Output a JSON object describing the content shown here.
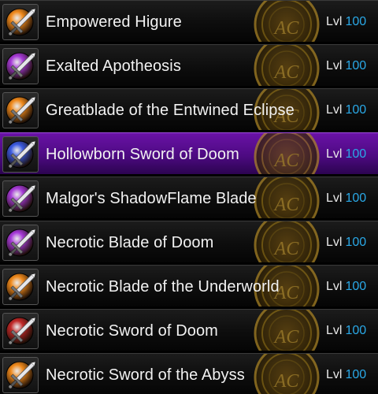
{
  "colors": {
    "row_bg": "#0d0d0d",
    "selected_bg": "#4d0a82",
    "text": "#f2f2f2",
    "level_value": "#2aa8e6",
    "badge_gold": "#8a6a14"
  },
  "items": [
    {
      "name": "Empowered Higure",
      "level_label": "Lvl",
      "level": "100",
      "orb_color": "#f08a1c",
      "icon": "sword-icon"
    },
    {
      "name": "Exalted Apotheosis",
      "level_label": "Lvl",
      "level": "100",
      "orb_color": "#a63ad8",
      "icon": "sword-icon"
    },
    {
      "name": "Greatblade of the Entwined Eclipse",
      "level_label": "Lvl",
      "level": "100",
      "orb_color": "#f08a1c",
      "icon": "sword-icon"
    },
    {
      "name": "Hollowborn Sword of Doom",
      "level_label": "Lvl",
      "level": "100",
      "orb_color": "#3a5ae0",
      "icon": "sword-icon",
      "selected": true
    },
    {
      "name": "Malgor's ShadowFlame Blade",
      "level_label": "Lvl",
      "level": "100",
      "orb_color": "#a63ad8",
      "icon": "sword-icon"
    },
    {
      "name": "Necrotic Blade of Doom",
      "level_label": "Lvl",
      "level": "100",
      "orb_color": "#a63ad8",
      "icon": "sword-icon"
    },
    {
      "name": "Necrotic Blade of the Underworld",
      "level_label": "Lvl",
      "level": "100",
      "orb_color": "#f08a1c",
      "icon": "sword-icon"
    },
    {
      "name": "Necrotic Sword of Doom",
      "level_label": "Lvl",
      "level": "100",
      "orb_color": "#c02828",
      "icon": "sword-icon"
    },
    {
      "name": "Necrotic Sword of the Abyss",
      "level_label": "Lvl",
      "level": "100",
      "orb_color": "#f08a1c",
      "icon": "sword-icon"
    }
  ],
  "badge": {
    "text": "AC",
    "icon": "ac-coin-icon"
  }
}
